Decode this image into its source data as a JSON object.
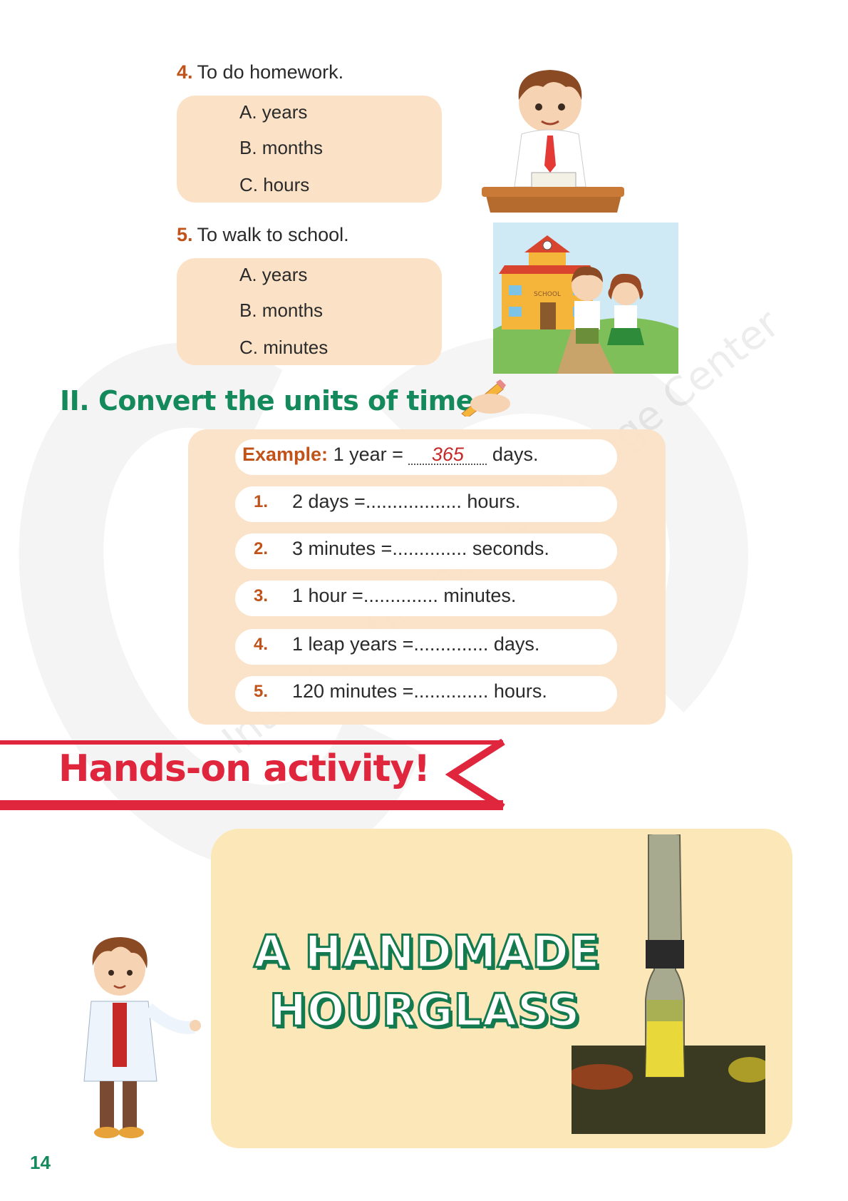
{
  "questions": [
    {
      "num": "4.",
      "title": "To do homework.",
      "options": [
        "A. years",
        "B. months",
        "C. hours"
      ]
    },
    {
      "num": "5.",
      "title": "To walk to school.",
      "options": [
        "A. years",
        "B. months",
        "C. minutes"
      ]
    }
  ],
  "school_sign": "SCHOOL",
  "section2": {
    "title": "II. Convert the units of time.",
    "example": {
      "label": "Example:",
      "before": "1 year =",
      "answer": "365",
      "after": "days."
    },
    "items": [
      {
        "num": "1.",
        "text": "2 days  =.................. hours."
      },
      {
        "num": "2.",
        "text": "3 minutes =.............. seconds."
      },
      {
        "num": "3.",
        "text": "1 hour =.............. minutes."
      },
      {
        "num": "4.",
        "text": "1 leap years =.............. days."
      },
      {
        "num": "5.",
        "text": "120 minutes =.............. hours."
      }
    ]
  },
  "banner": {
    "title": "Hands-on activity!"
  },
  "hands_on": {
    "title_line1": "A HANDMADE",
    "title_line2": "HOURGLASS"
  },
  "watermark": "Inter-Continental Language Center",
  "page_number": "14",
  "colors": {
    "accent_orange": "#c1531a",
    "green": "#148a5c",
    "red": "#e0263d",
    "box_peach": "#fbe2c7",
    "panel_yellow": "#fbe7b8"
  }
}
